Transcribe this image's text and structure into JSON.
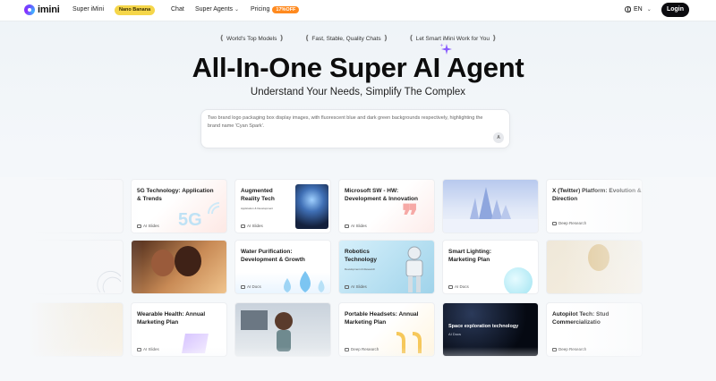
{
  "nav": {
    "brand": "imini",
    "links": [
      "Super iMini",
      "Chat"
    ],
    "nano_label": "Nano Banana",
    "super_agents": "Super Agents",
    "pricing": "Pricing",
    "pricing_badge": "17%OFF",
    "lang": "EN",
    "login": "Login"
  },
  "hero": {
    "taglines": [
      "World's Top Models",
      "Fast, Stable, Quality Chats",
      "Let Smart iMini Work for You"
    ],
    "title": "All-In-One Super AI Agent",
    "subtitle": "Understand Your Needs, Simplify The Complex",
    "prompt": "Two brand logo packaging box display images, with fluorescent blue and dark green backgrounds respectively, highlighting the brand name 'Cyan Spark'.",
    "send_label": "A"
  },
  "cards": {
    "c5g": {
      "title": "5G Technology: Application & Trends",
      "tag": "AI Slides",
      "art": "5G"
    },
    "ar": {
      "title": "Augmented Reality Tech",
      "sub": "Application & Development",
      "tag": "AI Slides"
    },
    "ms": {
      "title": "Microsoft SW - HW: Development & Innovation",
      "tag": "AI Slides"
    },
    "tw": {
      "title": "X (Twitter) Platform: Evolution & Direction",
      "tag": "Deep Research"
    },
    "water": {
      "title": "Water Purification: Development & Growth",
      "tag": "AI Docs"
    },
    "robot": {
      "title": "Robotics Technology",
      "sub": "Development & Research",
      "tag": "AI Slides"
    },
    "light": {
      "title": "Smart Lighting: Marketing Plan",
      "tag": "AI Docs"
    },
    "wear": {
      "title": "Wearable Health: Annual Marketing Plan",
      "tag": "AI Slides"
    },
    "head": {
      "title": "Portable Headsets: Annual Marketing Plan",
      "tag": "Deep Research"
    },
    "space": {
      "title": "Space exploration technology",
      "sub": "AI Docs"
    },
    "auto": {
      "title": "Autopilot Tech: Stud Commercializatio",
      "tag": "Deep Research"
    }
  },
  "colors": {
    "accent": "#6a4cff",
    "nano_badge": "#f5d64a",
    "discount": "#ff8a1f",
    "login_bg": "#0b0b0f"
  },
  "icons": [
    "imini-logo-icon",
    "chevron-down-icon",
    "globe-icon",
    "sparkle-icon",
    "send-icon"
  ]
}
